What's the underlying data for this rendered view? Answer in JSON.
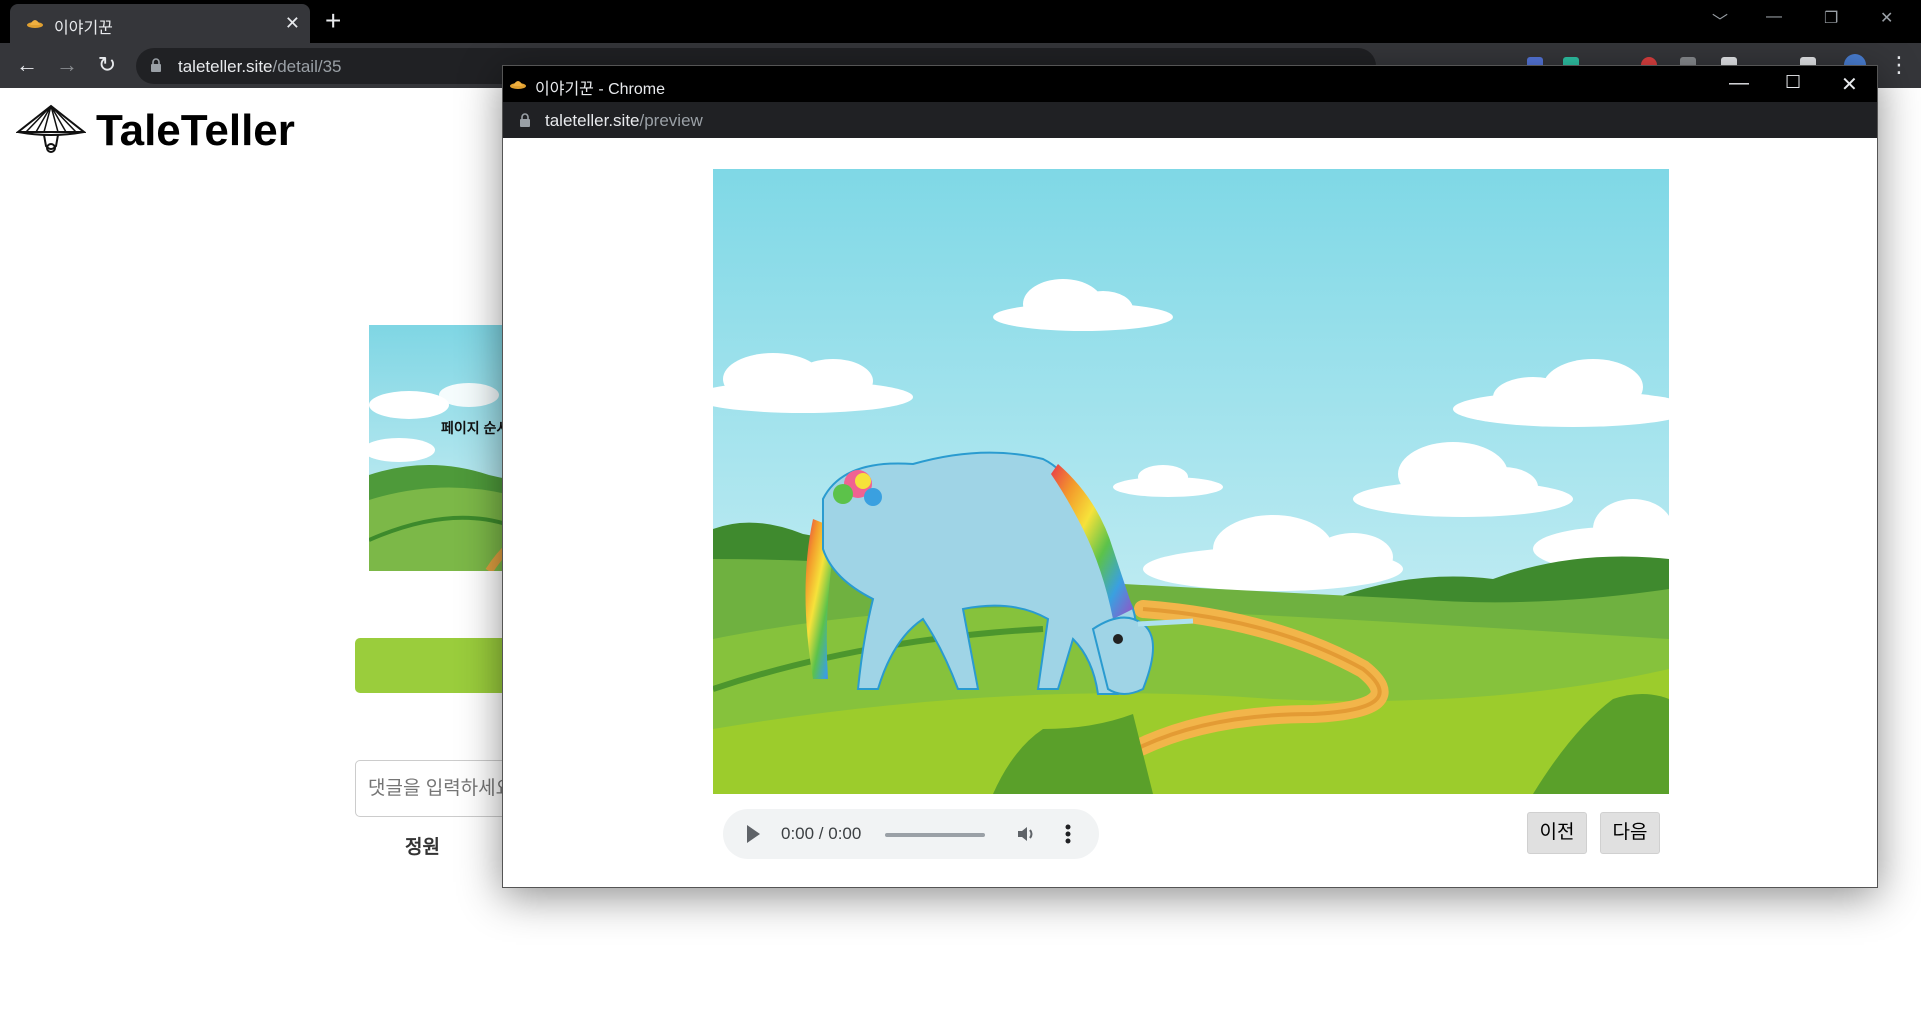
{
  "browser": {
    "tab_title": "이야기꾼",
    "url_host": "taleteller.site",
    "url_path": "/detail/35"
  },
  "page": {
    "brand": "TaleTeller",
    "thumbnail_label": "페이지 순서",
    "comment_placeholder": "댓글을 입력하세요",
    "comment_author": "정원"
  },
  "popup": {
    "window_title": "이야기꾼 - Chrome",
    "url_host": "taleteller.site",
    "url_path": "/preview",
    "audio_time": "0:00 / 0:00",
    "prev_label": "이전",
    "next_label": "다음"
  },
  "colors": {
    "accent_green": "#9acd3c",
    "sky": "#8ad8e6"
  }
}
